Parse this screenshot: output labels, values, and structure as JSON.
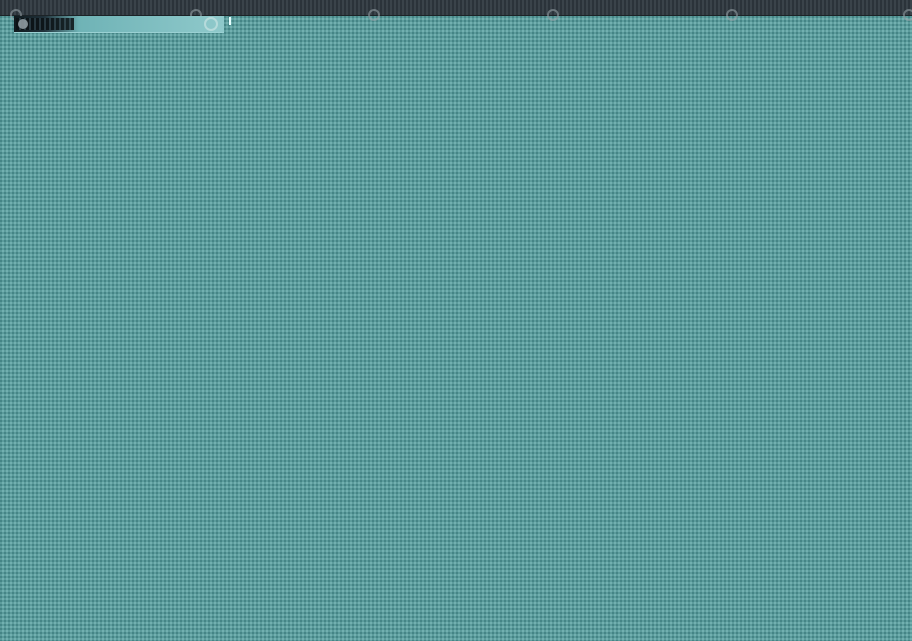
{
  "desktop": {
    "background_color": "#5c9c9c",
    "pattern": "teal-dither"
  },
  "top_strip": {
    "color": "#2b333a",
    "markers": [
      "circle-marker",
      "circle-marker",
      "circle-marker",
      "circle-marker",
      "circle-marker",
      "circle-marker"
    ]
  },
  "window_fragment": {
    "icon": "circle-icon",
    "accent_color": "#8fc9cb"
  }
}
